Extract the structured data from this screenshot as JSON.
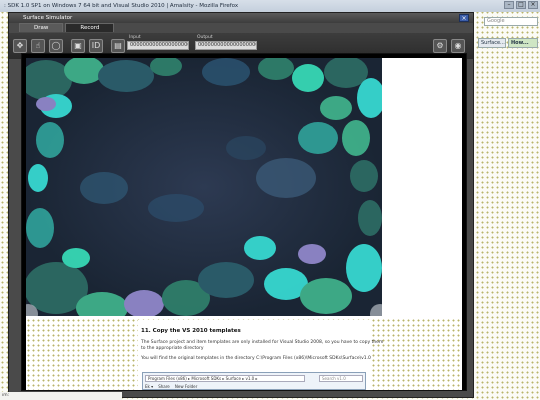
{
  "browser": {
    "title": ": SDK 1.0 SP1 on Windows 7 64 bit and Visual Studio 2010 | Amalsity - Mozilla Firefox",
    "search_placeholder": "Google",
    "tabs": [
      "Surface...",
      "How..."
    ],
    "status": "ım:"
  },
  "simulator": {
    "title": "Surface Simulator",
    "tabs": [
      "Draw",
      "Record"
    ],
    "fields": [
      {
        "label": "Input",
        "value": "0000000000000000000000"
      },
      {
        "label": "Output",
        "value": "0000000000000000000000"
      }
    ],
    "tools": [
      "move-tool-icon",
      "finger-tool-icon",
      "blob-tool-icon",
      "tag-tool-icon",
      "identity-tag-icon",
      "byte-tag-icon"
    ],
    "right_tools": [
      "settings-icon",
      "camera-icon"
    ]
  },
  "doc": {
    "heading": "11. Copy the VS 2010 templates",
    "para1": "The Surface project and item templates are only installed for Visual Studio 2008, so you have to copy them",
    "para1b": "to the appropriate directory",
    "para2": "You will find the original templates in the directory C:\\Program Files (x86)\\Microsoft SDKs\\Surface\\v1.0",
    "explorer_path": "Program Files (x86) ▸ Microsoft SDKs ▸ Surface ▸ v1.0 ▸",
    "explorer_search": "Search v1.0",
    "explorer_toolbar": [
      "Ek ▾",
      "Share",
      "New Folder"
    ]
  },
  "colors": {
    "dots": "#b8b46a",
    "teal": "#37d8d0",
    "green": "#2fa86a"
  }
}
